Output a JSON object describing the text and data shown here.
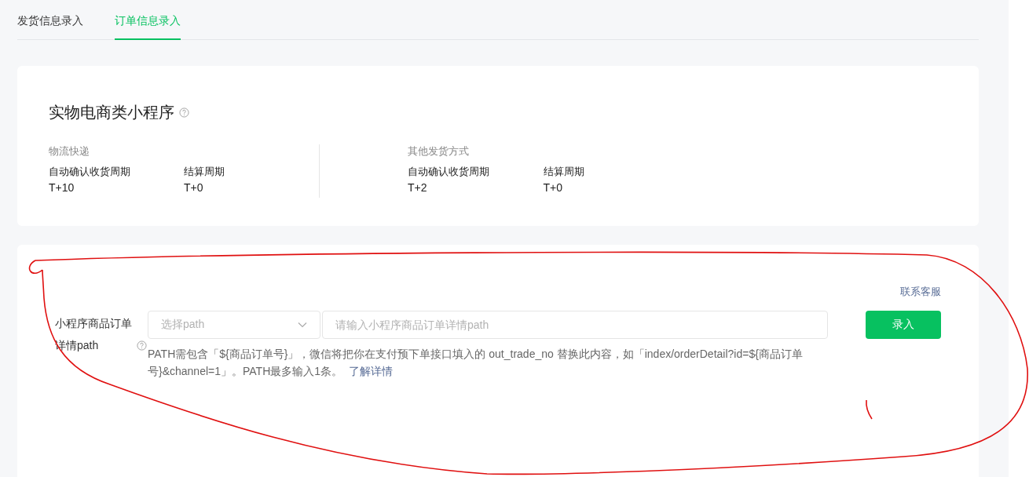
{
  "tabs": [
    {
      "label": "发货信息录入",
      "selected": false
    },
    {
      "label": "订单信息录入",
      "selected": true
    }
  ],
  "summary": {
    "title": "实物电商类小程序",
    "groups": [
      {
        "heading": "物流快递",
        "items": [
          {
            "label": "自动确认收货周期",
            "value": "T+10"
          },
          {
            "label": "结算周期",
            "value": "T+0"
          }
        ]
      },
      {
        "heading": "其他发货方式",
        "items": [
          {
            "label": "自动确认收货周期",
            "value": "T+2"
          },
          {
            "label": "结算周期",
            "value": "T+0"
          }
        ]
      }
    ]
  },
  "form": {
    "contact_link": "联系客服",
    "label": "小程序商品订单详情path",
    "select": {
      "placeholder": "选择path"
    },
    "input": {
      "placeholder": "请输入小程序商品订单详情path"
    },
    "help": "PATH需包含「${商品订单号}」，微信将把你在支付预下单接口填入的 out_trade_no 替换此内容，如「index/orderDetail?id=${商品订单号}&channel=1」。PATH最多输入1条。",
    "help_link": "了解详情",
    "submit": "录入"
  }
}
